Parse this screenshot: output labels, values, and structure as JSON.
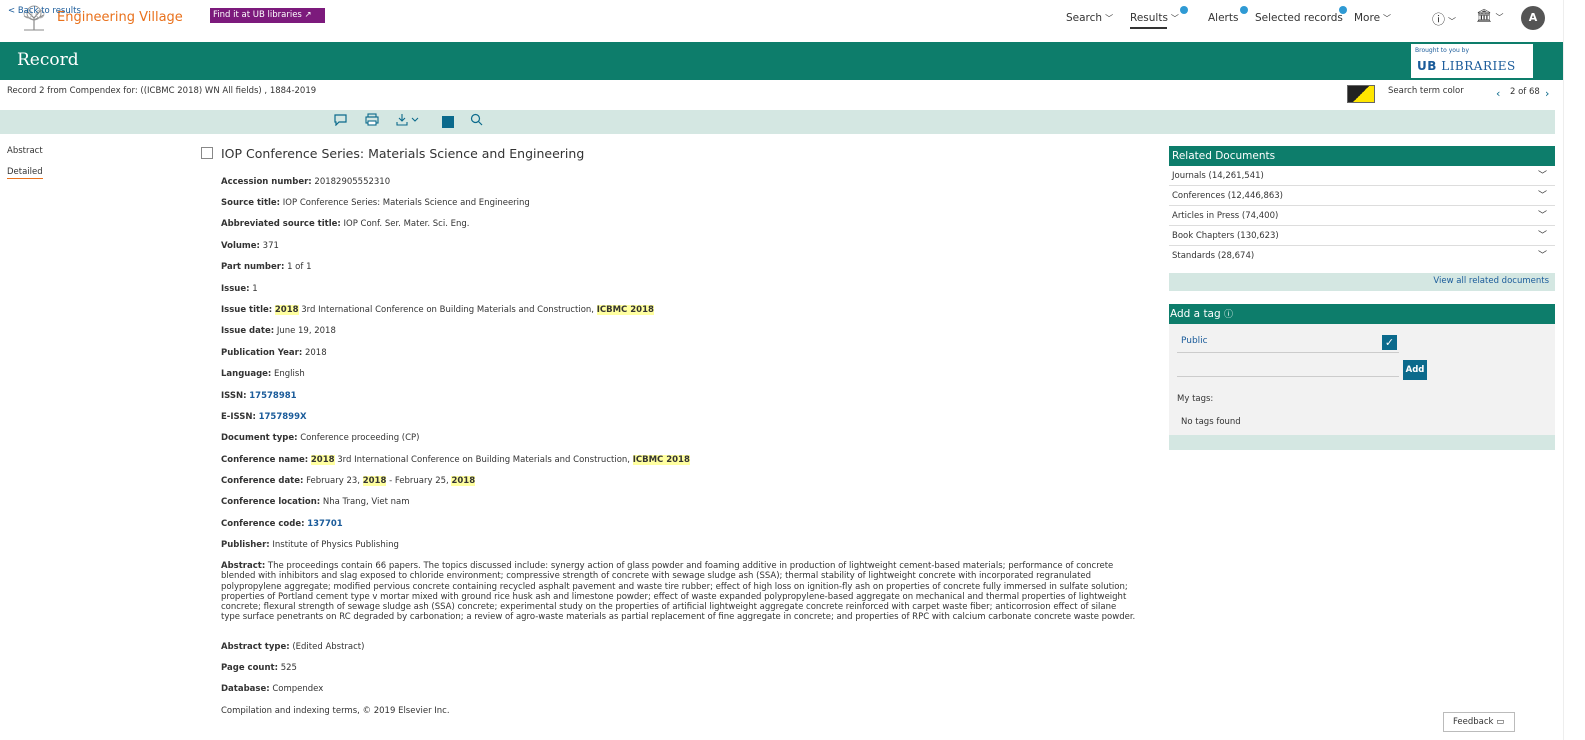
{
  "topnav": {
    "brand": "Engineering Village",
    "search": "Search",
    "results": "Results",
    "alerts": "Alerts",
    "selected_records": "Selected records",
    "more": "More",
    "avatar": "A"
  },
  "header": {
    "title": "Record",
    "brought_to_you": "Brought to you by",
    "libraries": "LIBRARIES"
  },
  "info": {
    "record_line": "Record 2 from Compendex for: ((ICBMC 2018) WN All fields) , 1884-2019",
    "search_term_color": "Search term color",
    "pager": "2 of 68"
  },
  "toolbar": {
    "back": "< Back to results",
    "find_it": "Find it at UB libraries ↗"
  },
  "leftnav": {
    "abstract": "Abstract",
    "detailed": "Detailed"
  },
  "doc": {
    "title": "IOP Conference Series: Materials Science and Engineering",
    "accession_label": "Accession number:",
    "accession": "20182905552310",
    "source_label": "Source title:",
    "source": "IOP Conference Series: Materials Science and Engineering",
    "abbrev_label": "Abbreviated source title:",
    "abbrev": "IOP Conf. Ser. Mater. Sci. Eng.",
    "volume_label": "Volume:",
    "volume": "371",
    "part_label": "Part number:",
    "part": "1 of 1",
    "issue_label": "Issue:",
    "issue": "1",
    "issue_title_label": "Issue title:",
    "issue_title_hl1": "2018",
    "issue_title_mid": "3rd International Conference on Building Materials and Construction,",
    "issue_title_hl2": "ICBMC 2018",
    "issue_date_label": "Issue date:",
    "issue_date": "June 19, 2018",
    "pub_year_label": "Publication Year:",
    "pub_year": "2018",
    "language_label": "Language:",
    "language": "English",
    "issn_label": "ISSN:",
    "issn": "17578981",
    "eissn_label": "E-ISSN:",
    "eissn": "1757899X",
    "doctype_label": "Document type:",
    "doctype": "Conference proceeding (CP)",
    "confname_label": "Conference name:",
    "confname_hl1": "2018",
    "confname_mid": "3rd International Conference on Building Materials and Construction,",
    "confname_hl2": "ICBMC 2018",
    "confdate_label": "Conference date:",
    "confdate_a": "February 23,",
    "confdate_hl1": "2018",
    "confdate_b": "- February 25,",
    "confdate_hl2": "2018",
    "confloc_label": "Conference location:",
    "confloc": "Nha Trang, Viet nam",
    "confcode_label": "Conference code:",
    "confcode": "137701",
    "publisher_label": "Publisher:",
    "publisher": "Institute of Physics Publishing",
    "abstract_label": "Abstract:",
    "abstract": "The proceedings contain 66 papers. The topics discussed include: synergy action of glass powder and foaming additive in production of lightweight cement-based materials; performance of concrete blended with inhibitors and slag exposed to chloride environment; compressive strength of concrete with sewage sludge ash (SSA); thermal stability of lightweight concrete with incorporated regranulated polypropylene aggregate; modified pervious concrete containing recycled asphalt pavement and waste tire rubber; effect of high loss on ignition-fly ash on properties of concrete fully immersed in sulfate solution; properties of Portland cement type v mortar mixed with ground rice husk ash and limestone powder; effect of waste expanded polypropylene-based aggregate on mechanical and thermal properties of lightweight concrete; flexural strength of sewage sludge ash (SSA) concrete; experimental study on the properties of artificial lightweight aggregate concrete reinforced with carpet waste fiber; anticorrosion effect of silane type surface penetrants on RC degraded by carbonation; a review of agro-waste materials as partial replacement of fine aggregate in concrete; and properties of RPC with calcium carbonate concrete waste powder.",
    "abstract_type_label": "Abstract type:",
    "abstract_type": "(Edited Abstract)",
    "page_count_label": "Page count:",
    "page_count": "525",
    "database_label": "Database:",
    "database": "Compendex",
    "copyright": "Compilation and indexing terms, © 2019 Elsevier Inc."
  },
  "related": {
    "title": "Related Documents",
    "items": [
      "Journals (14,261,541)",
      "Conferences (12,446,863)",
      "Articles in Press (74,400)",
      "Book Chapters (130,623)",
      "Standards (28,674)"
    ],
    "view_all": "View all related documents"
  },
  "tags": {
    "title": "Add a tag",
    "public": "Public",
    "add": "Add",
    "my_tags": "My tags:",
    "no_tags": "No tags found"
  },
  "feedback": "Feedback",
  "colors": {
    "green": "#0d7d6b",
    "orange": "#e9711c",
    "purple": "#7c1a7c",
    "light_teal": "#d4e7e2",
    "link": "#1a5b9a"
  }
}
